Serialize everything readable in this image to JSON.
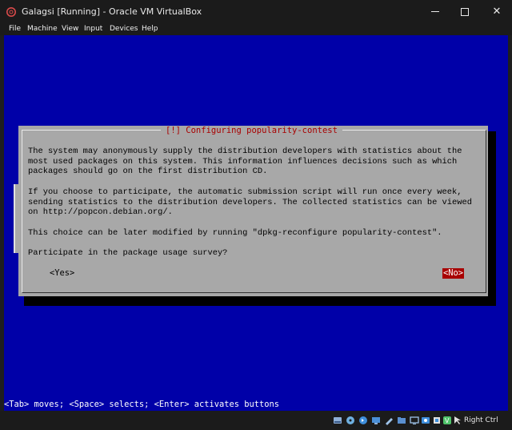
{
  "window": {
    "title": "Galagsi [Running] - Oracle VM VirtualBox",
    "controls": {
      "minimize": "",
      "maximize": "",
      "close": "✕"
    }
  },
  "menubar": {
    "items": [
      "File",
      "Machine",
      "View",
      "Input",
      "Devices",
      "Help"
    ]
  },
  "dialog": {
    "title": "[!] Configuring popularity-contest",
    "paragraph1": "The system may anonymously supply the distribution developers with statistics about the\nmost used packages on this system. This information influences decisions such as which\npackages should go on the first distribution CD.",
    "paragraph2": "If you choose to participate, the automatic submission script will run once every week,\nsending statistics to the distribution developers. The collected statistics can be viewed\non http://popcon.debian.org/.",
    "paragraph3": "This choice can be later modified by running \"dpkg-reconfigure popularity-contest\".",
    "question": "Participate in the package usage survey?",
    "yes_label": "<Yes>",
    "no_label": "<No>",
    "selected": "<No>"
  },
  "console": {
    "help_line": "<Tab> moves; <Space> selects; <Enter> activates buttons"
  },
  "statusbar": {
    "icons": [
      "hard-disk-icon",
      "optical-drive-icon",
      "audio-icon",
      "network-icon",
      "usb-icon",
      "shared-folders-icon",
      "display-icon",
      "recording-icon",
      "cpu-icon",
      "guest-additions-icon",
      "mouse-integration-icon",
      "keyboard-icon"
    ],
    "host_key": "Right Ctrl"
  },
  "colors": {
    "vm_background": "#0000a8",
    "dialog_background": "#a8a8a8",
    "title_red": "#a80000",
    "selected_button_bg": "#a80000",
    "window_chrome": "#1b1b1b"
  }
}
